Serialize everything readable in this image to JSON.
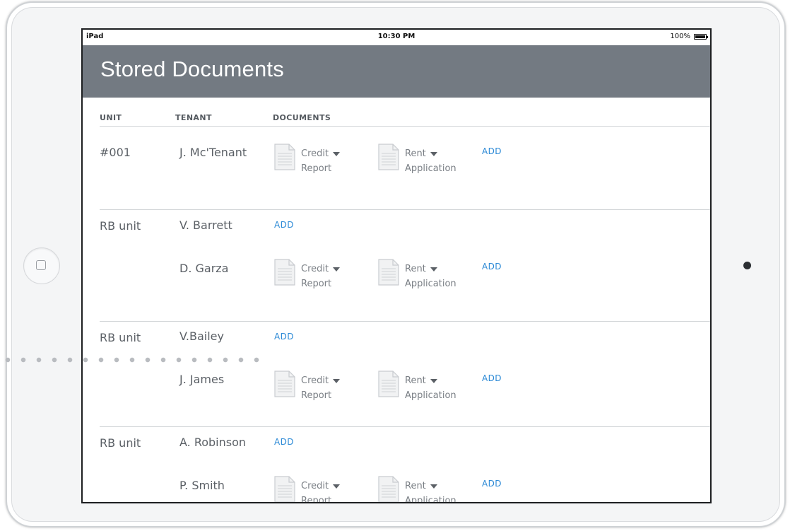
{
  "status_bar": {
    "carrier": "iPad",
    "time": "10:30 PM",
    "battery": "100%"
  },
  "header": {
    "title": "Stored Documents"
  },
  "columns": {
    "unit": "UNIT",
    "tenant": "TENANT",
    "documents": "DOCUMENTS"
  },
  "add_label": "ADD",
  "doc_types": {
    "credit": {
      "line1": "Credit",
      "line2": "Report"
    },
    "rent": {
      "line1": "Rent",
      "line2": "Application"
    }
  },
  "rows": [
    {
      "unit": "#001",
      "tenants": [
        {
          "name": "J. Mc'Tenant",
          "has_docs": true
        }
      ]
    },
    {
      "unit": "RB unit",
      "tenants": [
        {
          "name": "V. Barrett",
          "has_docs": false
        },
        {
          "name": "D. Garza",
          "has_docs": true
        }
      ]
    },
    {
      "unit": "RB unit",
      "tenants": [
        {
          "name": "V.Bailey",
          "has_docs": false
        },
        {
          "name": "J. James",
          "has_docs": true
        }
      ]
    },
    {
      "unit": "RB unit",
      "tenants": [
        {
          "name": "A. Robinson",
          "has_docs": false
        },
        {
          "name": "P. Smith",
          "has_docs": true
        }
      ]
    }
  ],
  "icons": {
    "document": "document-icon",
    "caret": "caret-down-icon",
    "home": "home-button-icon",
    "camera": "camera-icon"
  },
  "colors": {
    "header_bg": "#737a82",
    "link": "#2d8ad6"
  }
}
